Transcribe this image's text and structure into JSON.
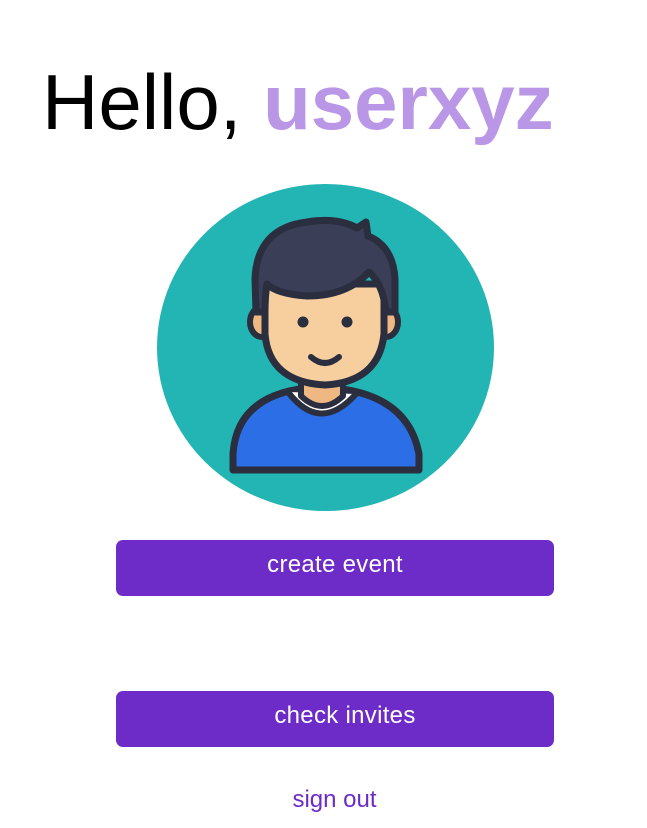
{
  "greeting": {
    "prefix": "Hello, ",
    "username": "userxyz"
  },
  "avatar": {
    "icon": "user-avatar-icon",
    "colors": {
      "background": "#22b5b4",
      "hair": "#3a3f57",
      "skin": "#f7cf9e",
      "shirt": "#2b6ee6",
      "outline": "#2b2e3f"
    }
  },
  "actions": {
    "create_event": "create event",
    "check_invites": "check invites",
    "sign_out": "sign out"
  },
  "colors": {
    "accent": "#6d2bc7",
    "username": "#b996e6"
  }
}
